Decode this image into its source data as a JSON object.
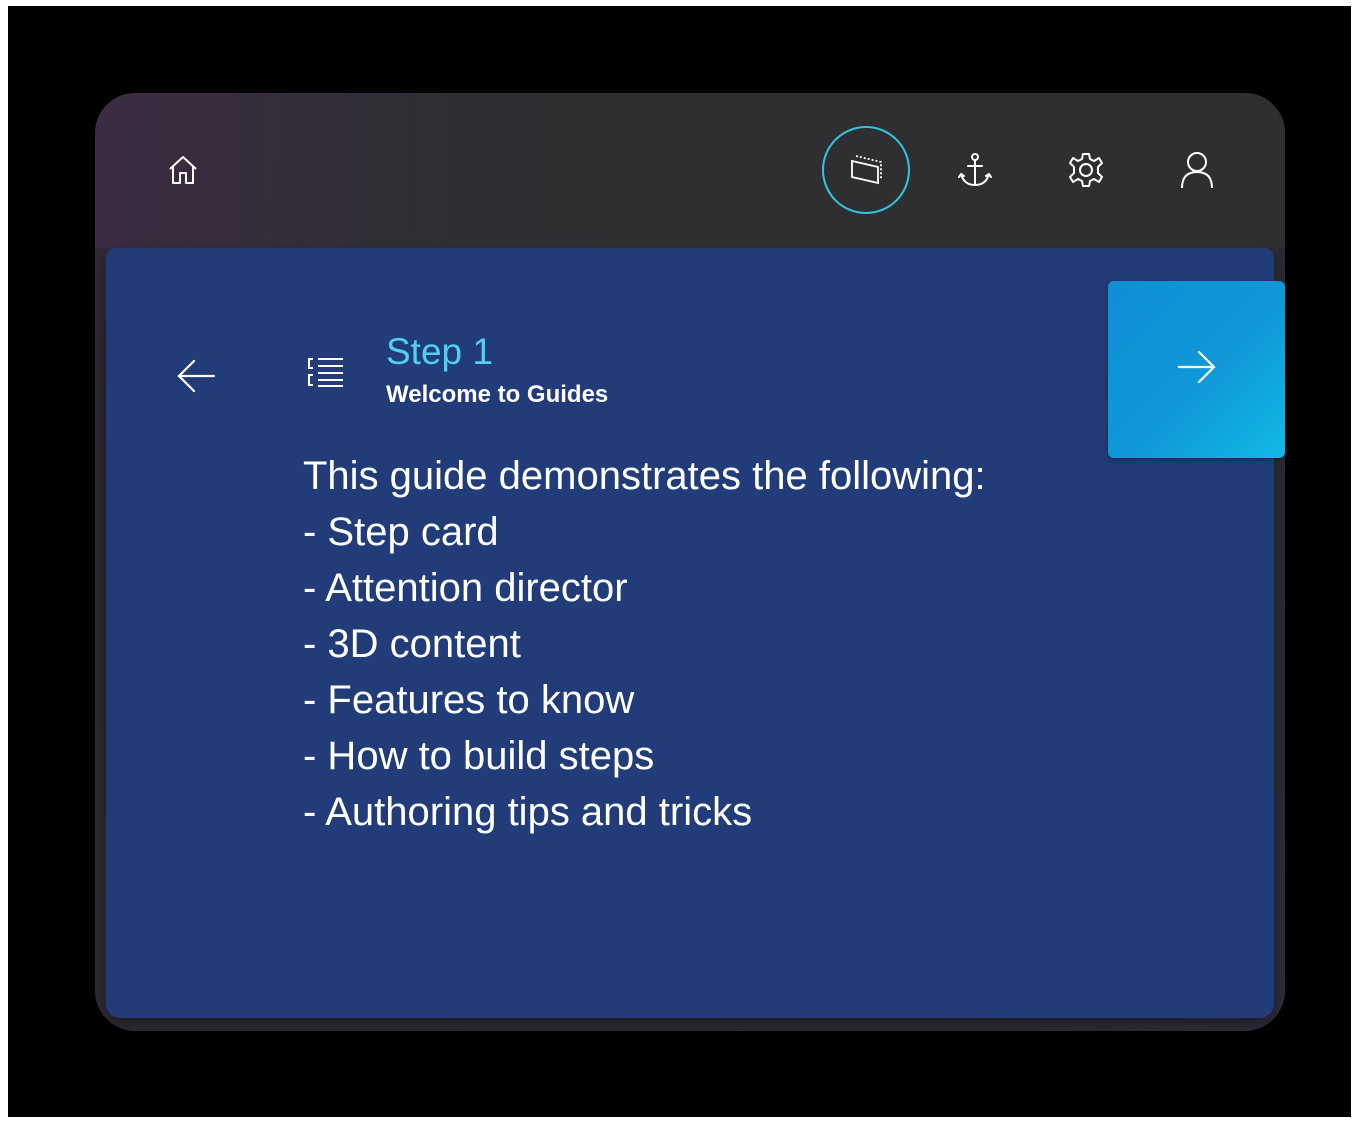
{
  "toolbar": {
    "icons": [
      "home-icon",
      "card-outline-icon",
      "anchor-icon",
      "gear-icon",
      "person-icon"
    ],
    "active": "card-outline-icon",
    "accent_color": "#32c6e3"
  },
  "step_card": {
    "step_label": "Step 1",
    "title": "Welcome to Guides",
    "body_lines": [
      "This guide demonstrates the following:",
      "- Step card",
      "- Attention director",
      "- 3D content",
      "- Features to know",
      "- How to build steps",
      "- Authoring tips and tricks"
    ],
    "card_color": "#213c78",
    "next_button_color": "#0e8fd6",
    "step_label_color": "#4fd0f0"
  }
}
